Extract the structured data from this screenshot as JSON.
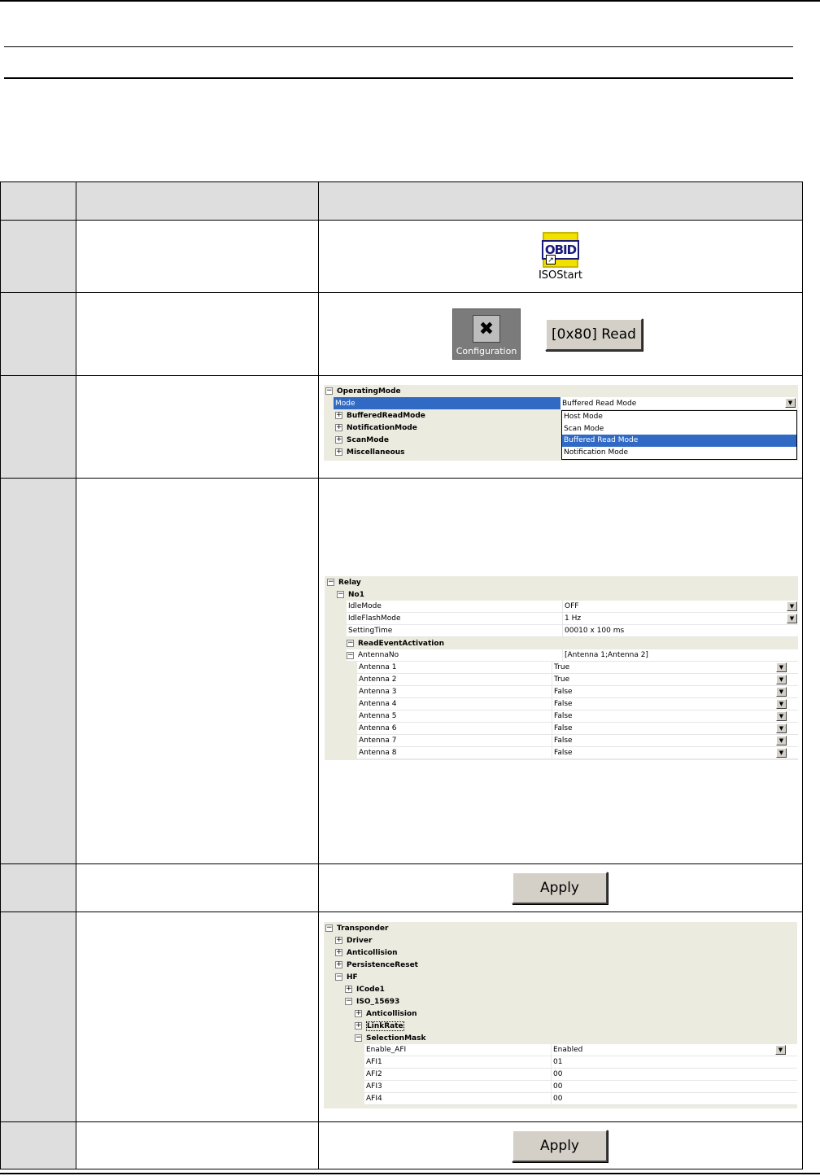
{
  "row1": {
    "icon_label": "ISOStart",
    "icon_text": "OBID"
  },
  "row2": {
    "config_label": "Configuration",
    "read_button": "[0x80] Read"
  },
  "row3": {
    "root": "OperatingMode",
    "mode_label": "Mode",
    "mode_value": "Buffered Read Mode",
    "items": [
      "BufferedReadMode",
      "NotificationMode",
      "ScanMode",
      "Miscellaneous"
    ],
    "options": [
      "Host Mode",
      "Scan Mode",
      "Buffered Read Mode",
      "Notification Mode"
    ],
    "selected_option": "Buffered Read Mode"
  },
  "row4": {
    "root": "Relay",
    "group": "No1",
    "props": [
      {
        "name": "IdleMode",
        "value": "OFF",
        "dropdown": true
      },
      {
        "name": "IdleFlashMode",
        "value": "1 Hz",
        "dropdown": true
      },
      {
        "name": "SettingTime",
        "value": "00010 x 100 ms",
        "dropdown": false
      }
    ],
    "sub_group": "ReadEventActivation",
    "antenna_no_label": "AntennaNo",
    "antenna_no_value": "[Antenna 1;Antenna 2]",
    "antennas": [
      {
        "name": "Antenna 1",
        "value": "True"
      },
      {
        "name": "Antenna 2",
        "value": "True"
      },
      {
        "name": "Antenna 3",
        "value": "False"
      },
      {
        "name": "Antenna 4",
        "value": "False"
      },
      {
        "name": "Antenna 5",
        "value": "False"
      },
      {
        "name": "Antenna 6",
        "value": "False"
      },
      {
        "name": "Antenna 7",
        "value": "False"
      },
      {
        "name": "Antenna 8",
        "value": "False"
      }
    ]
  },
  "row5": {
    "apply_button": "Apply"
  },
  "row6": {
    "root": "Transponder",
    "items": [
      "Driver",
      "Anticollision",
      "PersistenceReset"
    ],
    "hf": "HF",
    "icode": "ICode1",
    "iso": "ISO_15693",
    "iso_items": [
      "Anticollision",
      "LinkRate"
    ],
    "selection_mask": "SelectionMask",
    "props": [
      {
        "name": "Enable_AFI",
        "value": "Enabled",
        "dropdown": true
      },
      {
        "name": "AFI1",
        "value": "01",
        "dropdown": false
      },
      {
        "name": "AFI2",
        "value": "00",
        "dropdown": false
      },
      {
        "name": "AFI3",
        "value": "00",
        "dropdown": false
      },
      {
        "name": "AFI4",
        "value": "00",
        "dropdown": false
      }
    ]
  },
  "row7": {
    "apply_button": "Apply"
  }
}
